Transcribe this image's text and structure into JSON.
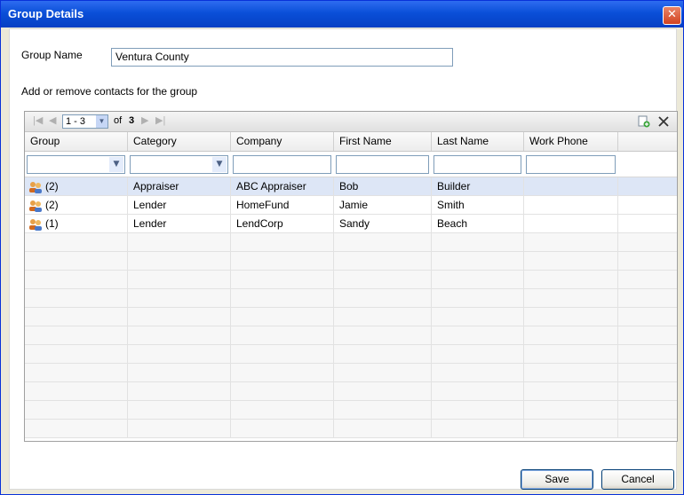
{
  "window": {
    "title": "Group Details",
    "close_glyph": "✕"
  },
  "form": {
    "group_name_label": "Group Name",
    "group_name_value": "Ventura County",
    "instructions": "Add or remove contacts for the group"
  },
  "pager": {
    "range": "1 - 3",
    "of_label": "of",
    "total_pages": "3"
  },
  "table": {
    "columns": [
      "Group",
      "Category",
      "Company",
      "First Name",
      "Last Name",
      "Work Phone"
    ],
    "rows": [
      {
        "group": "(2)",
        "category": "Appraiser",
        "company": "ABC Appraiser",
        "first_name": "Bob",
        "last_name": "Builder",
        "work_phone": ""
      },
      {
        "group": "(2)",
        "category": "Lender",
        "company": "HomeFund",
        "first_name": "Jamie",
        "last_name": "Smith",
        "work_phone": ""
      },
      {
        "group": "(1)",
        "category": "Lender",
        "company": "LendCorp",
        "first_name": "Sandy",
        "last_name": "Beach",
        "work_phone": ""
      }
    ]
  },
  "buttons": {
    "save": "Save",
    "cancel": "Cancel"
  },
  "colors": {
    "titlebar": "#0a4fd8",
    "selected_row": "#dde6f6"
  }
}
